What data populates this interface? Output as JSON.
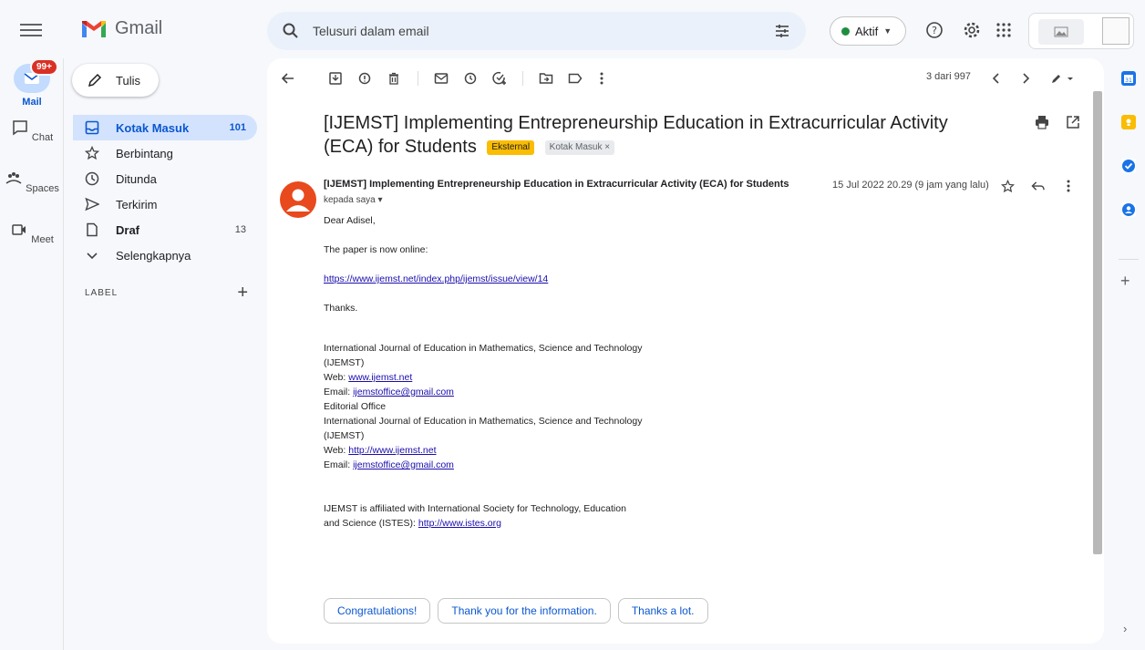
{
  "header": {
    "app_name": "Gmail",
    "search_placeholder": "Telusuri dalam email",
    "status_label": "Aktif"
  },
  "rail": {
    "mail_label": "Mail",
    "mail_badge": "99+",
    "chat_label": "Chat",
    "spaces_label": "Spaces",
    "meet_label": "Meet"
  },
  "sidebar": {
    "compose_label": "Tulis",
    "items": [
      {
        "label": "Kotak Masuk",
        "count": "101"
      },
      {
        "label": "Berbintang",
        "count": ""
      },
      {
        "label": "Ditunda",
        "count": ""
      },
      {
        "label": "Terkirim",
        "count": ""
      },
      {
        "label": "Draf",
        "count": "13"
      },
      {
        "label": "Selengkapnya",
        "count": ""
      }
    ],
    "labels_heading": "LABEL"
  },
  "toolbar": {
    "pager": "3 dari 997"
  },
  "message": {
    "subject": "[IJEMST] Implementing Entrepreneurship Education in Extracurricular Activity (ECA) for Students",
    "chip_external": "Eksternal",
    "chip_inbox": "Kotak Masuk ×",
    "sender": "[IJEMST] Implementing Entrepreneurship Education in Extracurricular Activity (ECA) for Students",
    "date": "15 Jul 2022 20.29 (9 jam yang lalu)",
    "to": "kepada saya ▾",
    "greeting": "Dear Adisel,",
    "line1": "The paper is now online:",
    "link1": "https://www.ijemst.net/index.php/ijemst/issue/view/14",
    "thanks": "Thanks.",
    "sig": {
      "org1": "International Journal of Education in Mathematics, Science and Technology",
      "abbr1": "(IJEMST)",
      "web1_prefix": "Web: ",
      "web1": "www.ijemst.net",
      "email1_prefix": "Email: ",
      "email1": "ijemstoffice@gmail.com",
      "office": "Editorial Office",
      "org2": "International Journal of Education in Mathematics, Science and Technology",
      "abbr2": "(IJEMST)",
      "web2_prefix": "Web: ",
      "web2": "http://www.ijemst.net",
      "email2_prefix": "Email: ",
      "email2": "ijemstoffice@gmail.com"
    },
    "affil1": "IJEMST is affiliated with International Society for Technology, Education",
    "affil2_prefix": "and Science (ISTES): ",
    "affil2_link": "http://www.istes.org"
  },
  "smart_replies": [
    "Congratulations!",
    "Thank you for the information.",
    "Thanks a lot."
  ],
  "colors": {
    "accent": "#0b57d0",
    "active_nav_bg": "#d3e3fd",
    "badge_red": "#d93025",
    "status_green": "#1e8e3e",
    "external_chip": "#fbbc04"
  }
}
